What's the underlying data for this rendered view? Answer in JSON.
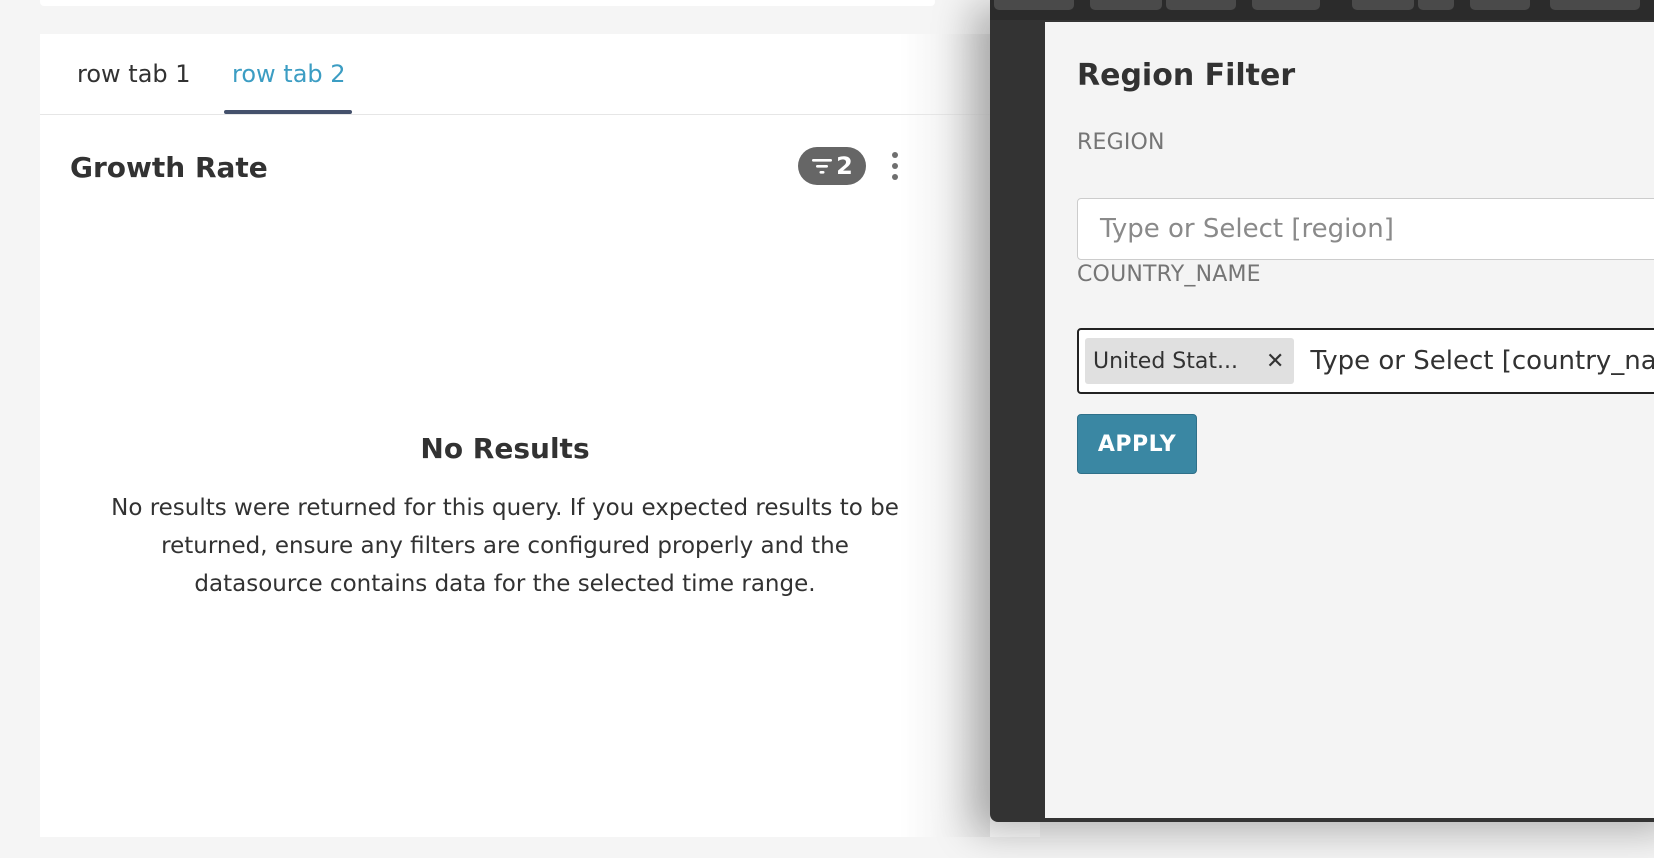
{
  "dashboard": {
    "tabs": [
      {
        "label": "row tab 1",
        "active": false
      },
      {
        "label": "row tab 2",
        "active": true
      }
    ],
    "chart": {
      "title": "Growth Rate",
      "filter_count": "2",
      "empty_title": "No Results",
      "empty_message": "No results were returned for this query. If you expected results to be returned, ensure any filters are configured properly and the datasource contains data for the selected time range."
    }
  },
  "filter_panel": {
    "title": "Region Filter",
    "fields": {
      "region": {
        "label": "REGION",
        "placeholder": "Type or Select [region]"
      },
      "country": {
        "label": "COUNTRY_NAME",
        "selected_chip": "United Stat...",
        "placeholder": "Type or Select [country_name]"
      }
    },
    "apply_label": "APPLY"
  },
  "colors": {
    "active_tab": "#3c9dc3",
    "tab_underline": "#44516c",
    "apply_button": "#3a87a3",
    "panel_background": "#333333"
  }
}
